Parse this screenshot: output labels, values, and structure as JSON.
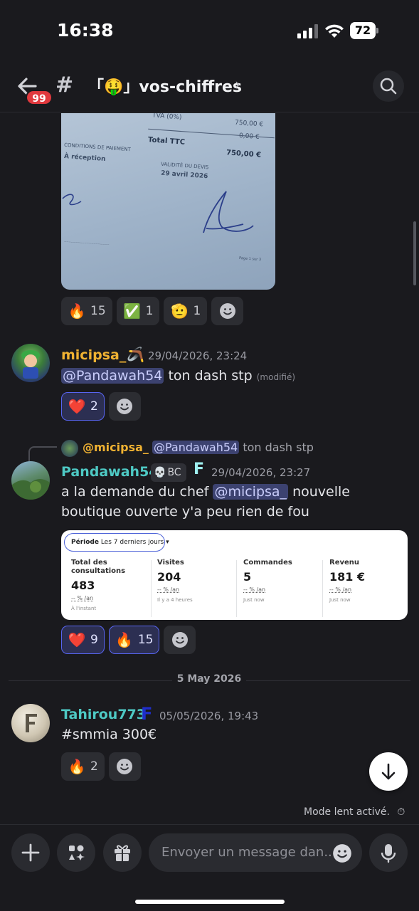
{
  "status_bar": {
    "time": "16:38",
    "battery": "72"
  },
  "header": {
    "unread_count": "99",
    "channel_name": "「🤑」vos-chiffres"
  },
  "messages": [
    {
      "type": "attachment",
      "document": {
        "vat": "TVA (0%)",
        "vat_value": "0,00 €",
        "ht_value": "750,00 €",
        "total_label": "Total TTC",
        "total_value": "750,00 €",
        "payment_label": "CONDITIONS DE PAIEMENT",
        "payment_value": "À réception",
        "validity_label": "VALIDITÉ DU DEVIS",
        "validity_value": "29 avril 2026",
        "page": "Page 1 sur 3"
      },
      "reactions": [
        {
          "emoji": "🔥",
          "count": "15",
          "selected": false
        },
        {
          "emoji": "✅",
          "count": "1",
          "selected": false
        },
        {
          "emoji": "🫡",
          "count": "1",
          "selected": false
        }
      ]
    },
    {
      "author": "micipsa_",
      "author_color": "#f0b232",
      "badge_emoji": "🪃",
      "timestamp": "29/04/2026, 23:24",
      "mention": "@Pandawah54",
      "text": " ton dash stp",
      "edited": "(modifié)",
      "reactions": [
        {
          "emoji": "❤️",
          "count": "2",
          "selected": true
        }
      ]
    },
    {
      "reply": {
        "author": "@micipsa_",
        "mention": "@Pandawah54",
        "text": "ton dash stp"
      },
      "author": "Pandawah54",
      "author_color": "#4ec9c4",
      "clan_tag": "BC",
      "clan_emoji": "💀",
      "badge_letter": "F",
      "timestamp": "29/04/2026, 23:27",
      "text_before": "a la demande du chef ",
      "mention": "@micipsa_",
      "text_after": " nouvelle boutique ouverte y'a peu rien de fou",
      "dashboard": {
        "period_label": "Période",
        "period_value": "Les 7 derniers jours ▾",
        "metrics": [
          {
            "label": "Total des consultations",
            "value": "483",
            "change": "-- % /an",
            "time": "À l'instant"
          },
          {
            "label": "Visites",
            "value": "204",
            "change": "-- % /an",
            "time": "Il y a 4 heures"
          },
          {
            "label": "Commandes",
            "value": "5",
            "change": "-- % /an",
            "time": "Just now"
          },
          {
            "label": "Revenu",
            "value": "181 €",
            "change": "-- % /an",
            "time": "Just now"
          }
        ]
      },
      "reactions": [
        {
          "emoji": "❤️",
          "count": "9",
          "selected": true
        },
        {
          "emoji": "🔥",
          "count": "15",
          "selected": true
        }
      ]
    },
    {
      "date_divider": "5 May 2026",
      "author": "Tahirou773",
      "author_color": "#4ec9c4",
      "badge_letter": "F",
      "timestamp": "05/05/2026, 19:43",
      "text": "#smmia 300€",
      "reactions": [
        {
          "emoji": "🔥",
          "count": "2",
          "selected": false
        }
      ]
    }
  ],
  "slowmode": "Mode lent activé.",
  "composer": {
    "placeholder": "Envoyer un message dan.."
  }
}
